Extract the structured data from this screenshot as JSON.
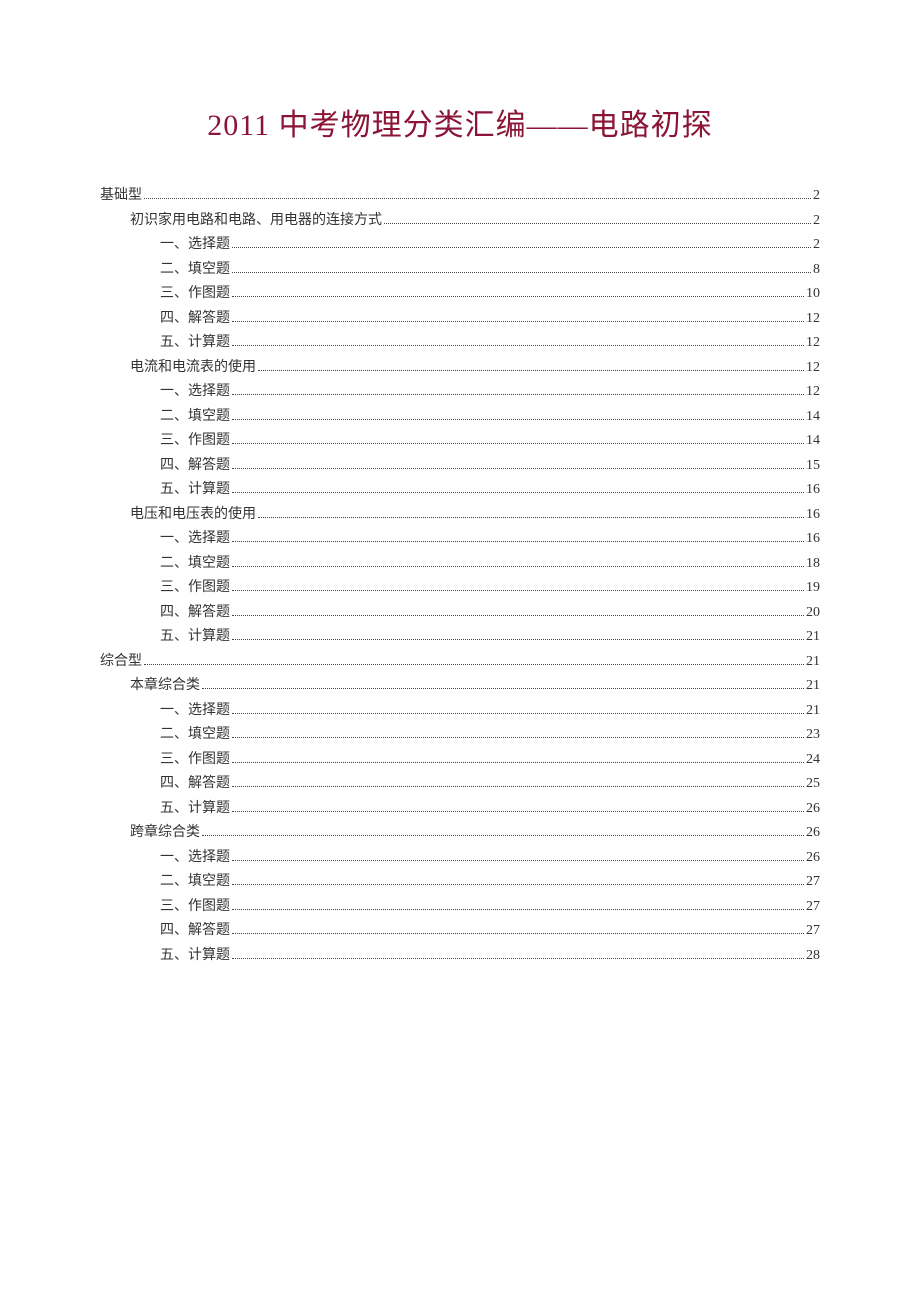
{
  "title": "2011 中考物理分类汇编——电路初探",
  "toc": [
    {
      "indent": 0,
      "label": "基础型",
      "page": "2"
    },
    {
      "indent": 1,
      "label": "初识家用电路和电路、用电器的连接方式",
      "page": "2"
    },
    {
      "indent": 2,
      "label": "一、选择题",
      "page": "2"
    },
    {
      "indent": 2,
      "label": "二、填空题",
      "page": "8"
    },
    {
      "indent": 2,
      "label": "三、作图题",
      "page": "10"
    },
    {
      "indent": 2,
      "label": "四、解答题",
      "page": "12"
    },
    {
      "indent": 2,
      "label": "五、计算题",
      "page": "12"
    },
    {
      "indent": 1,
      "label": "电流和电流表的使用",
      "page": "12"
    },
    {
      "indent": 2,
      "label": "一、选择题",
      "page": "12"
    },
    {
      "indent": 2,
      "label": "二、填空题",
      "page": "14"
    },
    {
      "indent": 2,
      "label": "三、作图题",
      "page": "14"
    },
    {
      "indent": 2,
      "label": "四、解答题",
      "page": "15"
    },
    {
      "indent": 2,
      "label": "五、计算题",
      "page": "16"
    },
    {
      "indent": 1,
      "label": "电压和电压表的使用",
      "page": "16"
    },
    {
      "indent": 2,
      "label": "一、选择题",
      "page": "16"
    },
    {
      "indent": 2,
      "label": "二、填空题",
      "page": "18"
    },
    {
      "indent": 2,
      "label": "三、作图题",
      "page": "19"
    },
    {
      "indent": 2,
      "label": "四、解答题",
      "page": "20"
    },
    {
      "indent": 2,
      "label": "五、计算题",
      "page": "21"
    },
    {
      "indent": 0,
      "label": "综合型",
      "page": "21"
    },
    {
      "indent": 1,
      "label": "本章综合类",
      "page": "21"
    },
    {
      "indent": 2,
      "label": "一、选择题",
      "page": "21"
    },
    {
      "indent": 2,
      "label": "二、填空题",
      "page": "23"
    },
    {
      "indent": 2,
      "label": "三、作图题",
      "page": "24"
    },
    {
      "indent": 2,
      "label": "四、解答题",
      "page": "25"
    },
    {
      "indent": 2,
      "label": "五、计算题",
      "page": "26"
    },
    {
      "indent": 1,
      "label": "跨章综合类",
      "page": "26"
    },
    {
      "indent": 2,
      "label": "一、选择题",
      "page": "26"
    },
    {
      "indent": 2,
      "label": "二、填空题",
      "page": "27"
    },
    {
      "indent": 2,
      "label": "三、作图题",
      "page": "27"
    },
    {
      "indent": 2,
      "label": "四、解答题",
      "page": "27"
    },
    {
      "indent": 2,
      "label": "五、计算题",
      "page": "28"
    }
  ]
}
